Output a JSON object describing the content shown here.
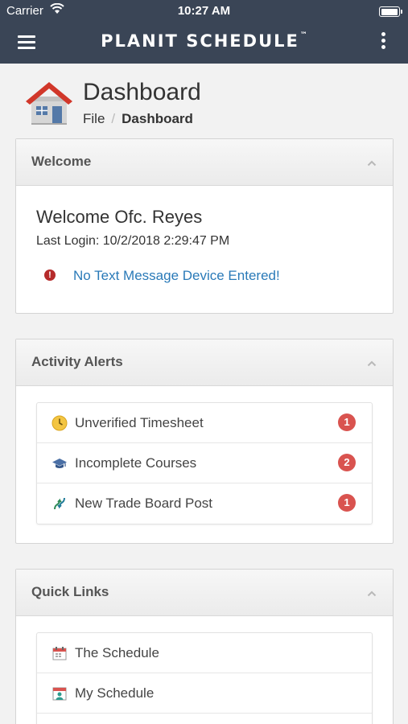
{
  "status_bar": {
    "carrier": "Carrier",
    "time": "10:27 AM",
    "battery_level": 1.0
  },
  "navbar": {
    "logo_text": "PLANIT SCHEDULE",
    "logo_mark": "™"
  },
  "page": {
    "title": "Dashboard",
    "breadcrumb": {
      "file": "File",
      "separator": "/",
      "current": "Dashboard"
    }
  },
  "welcome_panel": {
    "title": "Welcome",
    "greeting": "Welcome Ofc. Reyes",
    "last_login": "Last Login: 10/2/2018 2:29:47 PM",
    "warning_text": "No Text Message Device Entered!",
    "warning_icon_glyph": "!"
  },
  "alerts_panel": {
    "title": "Activity Alerts",
    "items": [
      {
        "label": "Unverified Timesheet",
        "count": "1",
        "icon": "clock-icon"
      },
      {
        "label": "Incomplete Courses",
        "count": "2",
        "icon": "graduation-cap-icon"
      },
      {
        "label": "New Trade Board Post",
        "count": "1",
        "icon": "trade-arrows-icon"
      }
    ]
  },
  "links_panel": {
    "title": "Quick Links",
    "items": [
      {
        "label": "The Schedule",
        "icon": "calendar-icon"
      },
      {
        "label": "My Schedule",
        "icon": "person-calendar-icon"
      }
    ]
  },
  "colors": {
    "navbar": "#3a4556",
    "badge": "#d9534f",
    "link": "#2a7ab8",
    "warning": "#b52b2b"
  }
}
